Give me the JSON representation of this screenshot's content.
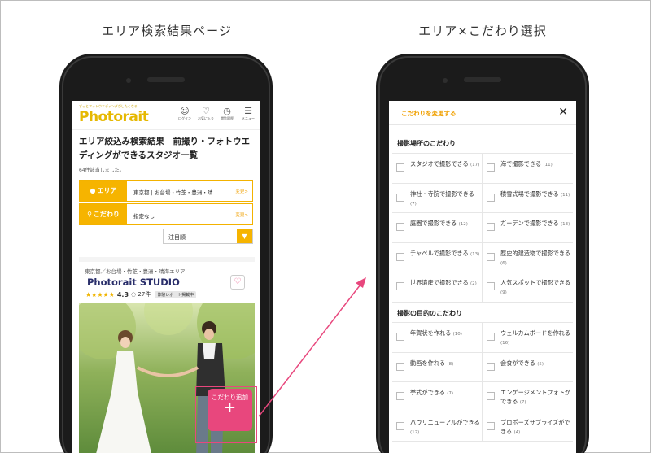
{
  "captions": {
    "left": "エリア検索結果ページ",
    "right": "エリア×こだわり選択"
  },
  "colors": {
    "accent": "#f6b400",
    "pink": "#e8477d",
    "navy": "#2a2f6b"
  },
  "left_screen": {
    "header": {
      "tagline": "ずっとフォトウエディングがしたくなる",
      "logo": "Photorait",
      "icons": [
        {
          "icon": "user-icon",
          "label": "ログイン"
        },
        {
          "icon": "heart-icon",
          "label": "お気に入り"
        },
        {
          "icon": "clock-icon",
          "label": "閲覧履歴"
        },
        {
          "icon": "menu-icon",
          "label": "メニュー"
        }
      ]
    },
    "result_title": "エリア絞込み検索結果　前撮り・フォトウエディングができるスタジオ一覧",
    "result_count": "64件該当しました。",
    "filters": [
      {
        "label": "エリア",
        "icon": "pin-icon",
        "value": "東京都 | お台場・竹芝・豊洲・晴…",
        "change": "変更>"
      },
      {
        "label": "こだわり",
        "icon": "search-icon",
        "value": "指定なし",
        "change": "変更>"
      }
    ],
    "sort": {
      "value": "注目順",
      "arrow": "▼"
    },
    "card": {
      "area": "東京都／お台場・竹芝・豊洲・晴海エリア",
      "name": "Photorait STUDIO",
      "stars": "★★★★★",
      "rating": "4.3",
      "reviews": "27件",
      "badge": "体験レポート掲載中"
    },
    "plus_button": {
      "label": "こだわり追加",
      "symbol": "+"
    }
  },
  "right_screen": {
    "header_title": "こだわりを変更する",
    "close": "✕",
    "sections": [
      {
        "title": "撮影場所のこだわり",
        "items": [
          {
            "label": "スタジオで撮影できる",
            "count": "(17)"
          },
          {
            "label": "海で撮影できる",
            "count": "(11)"
          },
          {
            "label": "神社・寺院で撮影できる",
            "count": "(7)"
          },
          {
            "label": "積雪式場で撮影できる",
            "count": "(11)"
          },
          {
            "label": "庭園で撮影できる",
            "count": "(12)"
          },
          {
            "label": "ガーデンで撮影できる",
            "count": "(13)"
          },
          {
            "label": "チャペルで撮影できる",
            "count": "(13)"
          },
          {
            "label": "歴史的建造物で撮影できる",
            "count": "(6)"
          },
          {
            "label": "世界遺産で撮影できる",
            "count": "(2)"
          },
          {
            "label": "人気スポットで撮影できる",
            "count": "(9)"
          }
        ]
      },
      {
        "title": "撮影の目的のこだわり",
        "items": [
          {
            "label": "年賀状を作れる",
            "count": "(10)"
          },
          {
            "label": "ウェルカムボードを作れる",
            "count": "(16)"
          },
          {
            "label": "動画を作れる",
            "count": "(8)"
          },
          {
            "label": "会食ができる",
            "count": "(5)"
          },
          {
            "label": "挙式ができる",
            "count": "(7)"
          },
          {
            "label": "エンゲージメントフォトができる",
            "count": "(7)"
          },
          {
            "label": "バウリニューアルができる",
            "count": "(12)"
          },
          {
            "label": "プロポーズサプライズができる",
            "count": "(4)"
          }
        ]
      }
    ]
  }
}
